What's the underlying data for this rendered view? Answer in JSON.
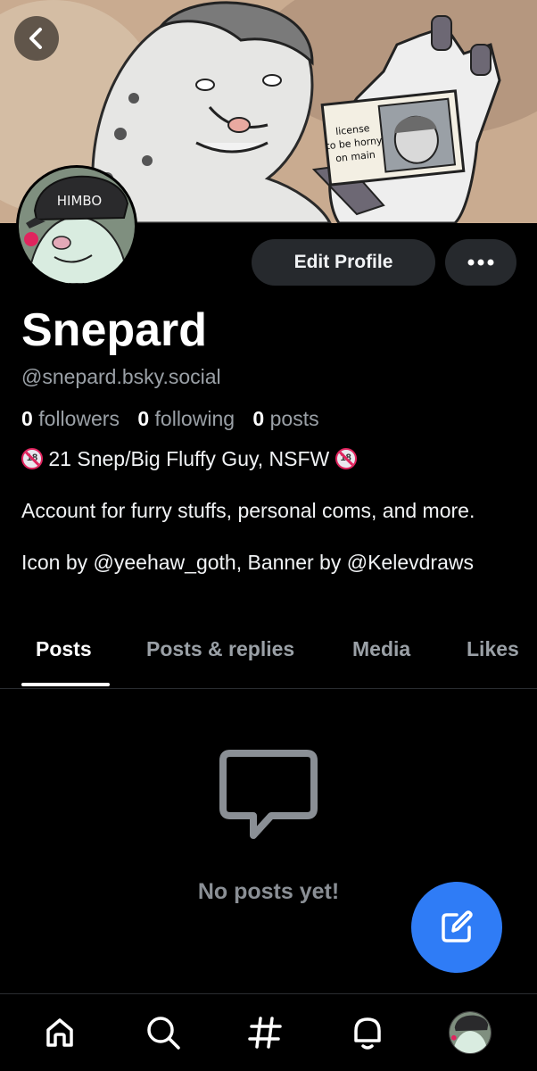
{
  "banner": {
    "sign_text": [
      "license",
      "to be horny",
      "on main"
    ]
  },
  "avatar": {
    "cap_text": "HIMBO"
  },
  "actions": {
    "edit_profile_label": "Edit Profile"
  },
  "profile": {
    "display_name": "Snepard",
    "handle": "@snepard.bsky.social",
    "stats": {
      "followers_count": "0",
      "followers_label": "followers",
      "following_count": "0",
      "following_label": "following",
      "posts_count": "0",
      "posts_label": "posts"
    },
    "bio": {
      "line1": " 21 Snep/Big Fluffy Guy, NSFW ",
      "line2": "Account for furry stuffs, personal coms, and more.",
      "line3": "Icon by @yeehaw_goth, Banner by @Kelevdraws"
    },
    "badge_text": "18"
  },
  "tabs": [
    {
      "label": "Posts",
      "active": true
    },
    {
      "label": "Posts & replies",
      "active": false
    },
    {
      "label": "Media",
      "active": false
    },
    {
      "label": "Likes",
      "active": false
    }
  ],
  "feed": {
    "empty_text": "No posts yet!"
  },
  "colors": {
    "accent": "#2f7cf6",
    "background": "#000000",
    "button_bg": "#26292d",
    "muted_text": "#9aa0a6"
  },
  "icons": {
    "back": "chevron-left-icon",
    "more": "ellipsis-icon",
    "empty": "speech-bubble-icon",
    "compose": "compose-icon",
    "home": "home-icon",
    "search": "search-icon",
    "feeds": "hashtag-icon",
    "notifications": "bell-icon"
  }
}
